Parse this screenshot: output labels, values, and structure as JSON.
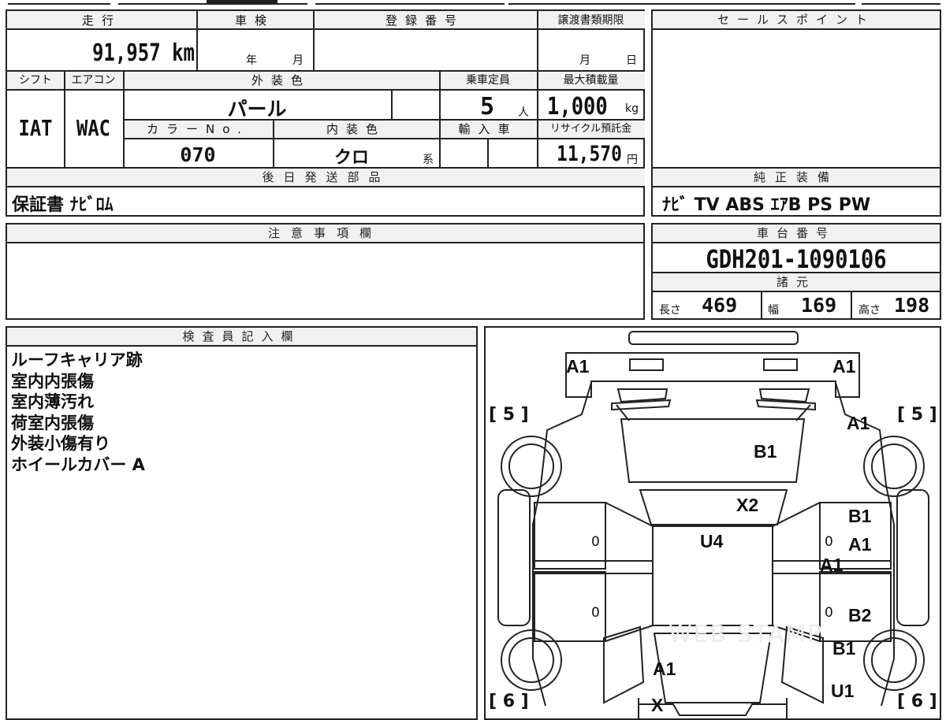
{
  "top_row": {
    "mileage_label": "走行",
    "mileage_value": "91,957",
    "mileage_unit": "km",
    "inspection_label": "車検",
    "inspection_year_unit": "年",
    "inspection_month_unit": "月",
    "registration_label": "登録番号",
    "transfer_label": "譲渡書類期限",
    "transfer_month_unit": "月",
    "transfer_day_unit": "日"
  },
  "mid_row": {
    "shift_label": "シフト",
    "shift_value": "IAT",
    "ac_label": "エアコン",
    "ac_value": "WAC",
    "exterior_color_label": "外装色",
    "exterior_color_value": "パール",
    "capacity_label": "乗車定員",
    "capacity_value": "5",
    "capacity_unit": "人",
    "max_load_label": "最大積載量",
    "max_load_value": "1,000",
    "max_load_unit": "kg",
    "color_no_label": "カラーNo.",
    "color_no_value": "070",
    "interior_color_label": "内装色",
    "interior_color_value": "クロ",
    "interior_color_suffix": "系",
    "import_label": "輸入車",
    "recycle_label": "リサイクル預託金",
    "recycle_value": "11,570",
    "recycle_unit": "円"
  },
  "sales_point": {
    "label": "セールスポイント"
  },
  "later_parts": {
    "label": "後日発送部品",
    "value": "保証書 ﾅﾋﾞﾛﾑ"
  },
  "equipment": {
    "label": "純正装備",
    "value": "ﾅﾋﾞ TV ABS ｴｱB PS PW"
  },
  "notes": {
    "label": "注意事項欄"
  },
  "chassis": {
    "label": "車台番号",
    "value": "GDH201-1090106"
  },
  "specs": {
    "label": "諸元",
    "length_label": "長さ",
    "length_value": "469",
    "width_label": "幅",
    "width_value": "169",
    "height_label": "高さ",
    "height_value": "198"
  },
  "inspector": {
    "label": "検査員記入欄",
    "lines": [
      "ルーフキャリア跡",
      "室内内張傷",
      "室内薄汚れ",
      "荷室内張傷",
      "外装小傷有り",
      "ホイールカバー A"
    ]
  },
  "diagram": {
    "tire_front_left": "[ 5 ]",
    "tire_front_right": "[ 5 ]",
    "tire_rear_left": "[ 6 ]",
    "tire_rear_right": "[ 6 ]",
    "marks": [
      "A1",
      "A1",
      "A1",
      "B1",
      "X2",
      "U4",
      "B1",
      "A1",
      "A1",
      "B2",
      "B1",
      "A1",
      "U1",
      "X"
    ],
    "zero_a": "0",
    "zero_b": "0",
    "zero_c": "0",
    "zero_d": "0",
    "watermark": "WEB STAMP"
  }
}
